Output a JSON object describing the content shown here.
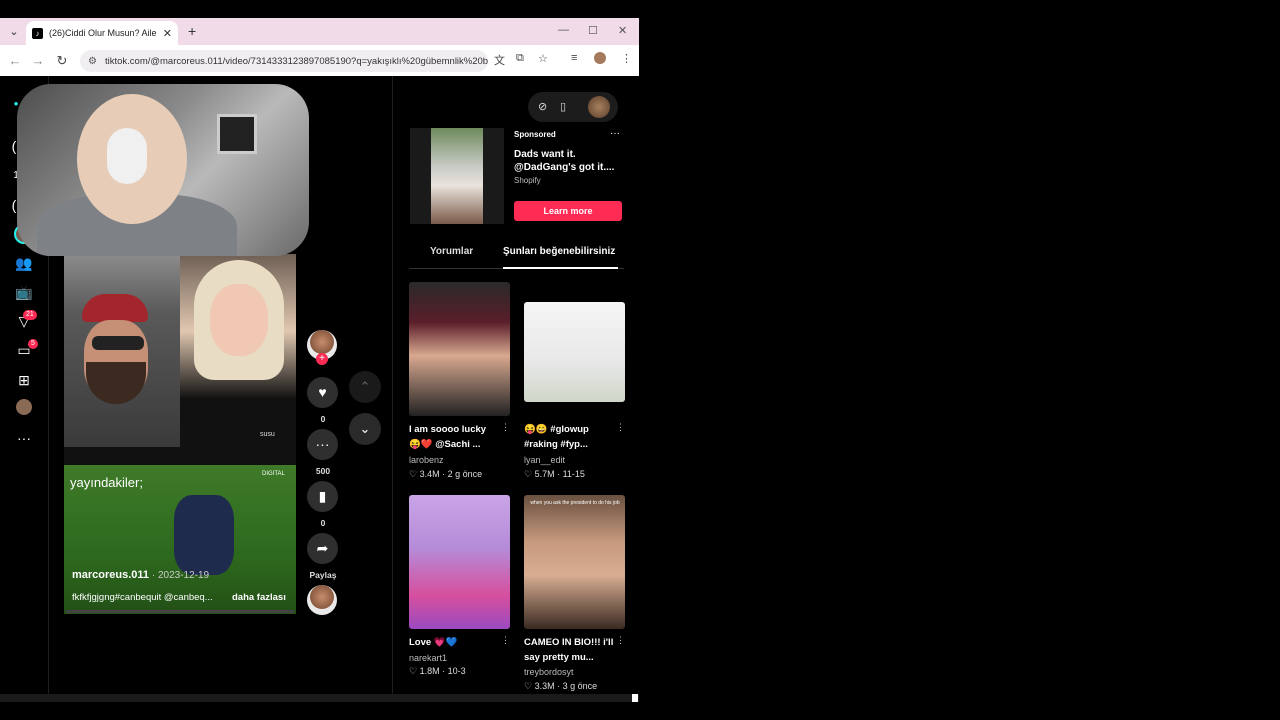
{
  "browser": {
    "tab_title": "(26)Ciddi Olur Musun? Aile ve D",
    "tab_close": "✕",
    "new_tab": "+",
    "url": "tiktok.com/@marcoreus.011/video/7314333123897085190?q=yakışıklı%20gübemnlik%20b...",
    "icons": [
      "chevron-down-icon",
      "back-icon",
      "forward-icon",
      "reload-icon",
      "site-info-icon",
      "translate-icon",
      "cast-icon",
      "star-icon",
      "media-icon",
      "profile-icon",
      "menu-icon"
    ]
  },
  "leftnav": {
    "badges": {
      "inbox": "21",
      "messages": "5"
    }
  },
  "video": {
    "overlay_text": "yayındakiler;",
    "watermark": "DIGITAL",
    "tag_text": "susu",
    "author": "marcoreus.011",
    "date": " · 2023-12-19",
    "description": "fkfkfjgjgng#canbequit @canbeq...",
    "more_label": "daha fazlası"
  },
  "actions": {
    "like_count": "0",
    "comment_count": "500",
    "save_count": "0",
    "share_label": "Paylaş"
  },
  "ad": {
    "sponsored": "Sponsored",
    "title": "Dads want it. @DadGang's got it....",
    "brand": "Shopify",
    "button": "Learn more",
    "more": "···"
  },
  "tabs": {
    "comments": "Yorumlar",
    "suggested": "Şunları beğenebilirsiniz"
  },
  "cards": [
    {
      "title": "I am soooo lucky 😝❤️ @Sachi ...",
      "author": "larobenz",
      "stats": "♡ 3.4M · 2 g önce"
    },
    {
      "title": "😝😀 #glowup #raking #fyp...",
      "author": "lyan__edit",
      "stats": "♡ 5.7M · 11-15"
    },
    {
      "title": "Love 💗💙",
      "author": "narekart1",
      "stats": "♡ 1.8M · 10-3"
    },
    {
      "title": "CAMEO IN BIO!!! i'll say pretty mu...",
      "author": "treybordosyt",
      "stats": "♡ 3.3M · 3 g önce"
    }
  ],
  "card4_caption": "when you ask the president to do his job",
  "colors": {
    "accent": "#fe2c55",
    "tabstrip": "#f1dbe8"
  }
}
